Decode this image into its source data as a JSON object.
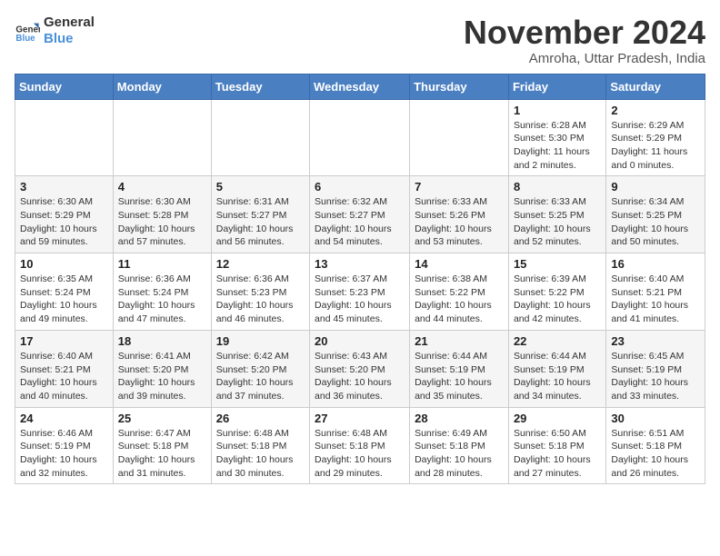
{
  "logo": {
    "line1": "General",
    "line2": "Blue"
  },
  "title": "November 2024",
  "location": "Amroha, Uttar Pradesh, India",
  "days_of_week": [
    "Sunday",
    "Monday",
    "Tuesday",
    "Wednesday",
    "Thursday",
    "Friday",
    "Saturday"
  ],
  "weeks": [
    [
      {
        "day": "",
        "info": ""
      },
      {
        "day": "",
        "info": ""
      },
      {
        "day": "",
        "info": ""
      },
      {
        "day": "",
        "info": ""
      },
      {
        "day": "",
        "info": ""
      },
      {
        "day": "1",
        "info": "Sunrise: 6:28 AM\nSunset: 5:30 PM\nDaylight: 11 hours and 2 minutes."
      },
      {
        "day": "2",
        "info": "Sunrise: 6:29 AM\nSunset: 5:29 PM\nDaylight: 11 hours and 0 minutes."
      }
    ],
    [
      {
        "day": "3",
        "info": "Sunrise: 6:30 AM\nSunset: 5:29 PM\nDaylight: 10 hours and 59 minutes."
      },
      {
        "day": "4",
        "info": "Sunrise: 6:30 AM\nSunset: 5:28 PM\nDaylight: 10 hours and 57 minutes."
      },
      {
        "day": "5",
        "info": "Sunrise: 6:31 AM\nSunset: 5:27 PM\nDaylight: 10 hours and 56 minutes."
      },
      {
        "day": "6",
        "info": "Sunrise: 6:32 AM\nSunset: 5:27 PM\nDaylight: 10 hours and 54 minutes."
      },
      {
        "day": "7",
        "info": "Sunrise: 6:33 AM\nSunset: 5:26 PM\nDaylight: 10 hours and 53 minutes."
      },
      {
        "day": "8",
        "info": "Sunrise: 6:33 AM\nSunset: 5:25 PM\nDaylight: 10 hours and 52 minutes."
      },
      {
        "day": "9",
        "info": "Sunrise: 6:34 AM\nSunset: 5:25 PM\nDaylight: 10 hours and 50 minutes."
      }
    ],
    [
      {
        "day": "10",
        "info": "Sunrise: 6:35 AM\nSunset: 5:24 PM\nDaylight: 10 hours and 49 minutes."
      },
      {
        "day": "11",
        "info": "Sunrise: 6:36 AM\nSunset: 5:24 PM\nDaylight: 10 hours and 47 minutes."
      },
      {
        "day": "12",
        "info": "Sunrise: 6:36 AM\nSunset: 5:23 PM\nDaylight: 10 hours and 46 minutes."
      },
      {
        "day": "13",
        "info": "Sunrise: 6:37 AM\nSunset: 5:23 PM\nDaylight: 10 hours and 45 minutes."
      },
      {
        "day": "14",
        "info": "Sunrise: 6:38 AM\nSunset: 5:22 PM\nDaylight: 10 hours and 44 minutes."
      },
      {
        "day": "15",
        "info": "Sunrise: 6:39 AM\nSunset: 5:22 PM\nDaylight: 10 hours and 42 minutes."
      },
      {
        "day": "16",
        "info": "Sunrise: 6:40 AM\nSunset: 5:21 PM\nDaylight: 10 hours and 41 minutes."
      }
    ],
    [
      {
        "day": "17",
        "info": "Sunrise: 6:40 AM\nSunset: 5:21 PM\nDaylight: 10 hours and 40 minutes."
      },
      {
        "day": "18",
        "info": "Sunrise: 6:41 AM\nSunset: 5:20 PM\nDaylight: 10 hours and 39 minutes."
      },
      {
        "day": "19",
        "info": "Sunrise: 6:42 AM\nSunset: 5:20 PM\nDaylight: 10 hours and 37 minutes."
      },
      {
        "day": "20",
        "info": "Sunrise: 6:43 AM\nSunset: 5:20 PM\nDaylight: 10 hours and 36 minutes."
      },
      {
        "day": "21",
        "info": "Sunrise: 6:44 AM\nSunset: 5:19 PM\nDaylight: 10 hours and 35 minutes."
      },
      {
        "day": "22",
        "info": "Sunrise: 6:44 AM\nSunset: 5:19 PM\nDaylight: 10 hours and 34 minutes."
      },
      {
        "day": "23",
        "info": "Sunrise: 6:45 AM\nSunset: 5:19 PM\nDaylight: 10 hours and 33 minutes."
      }
    ],
    [
      {
        "day": "24",
        "info": "Sunrise: 6:46 AM\nSunset: 5:19 PM\nDaylight: 10 hours and 32 minutes."
      },
      {
        "day": "25",
        "info": "Sunrise: 6:47 AM\nSunset: 5:18 PM\nDaylight: 10 hours and 31 minutes."
      },
      {
        "day": "26",
        "info": "Sunrise: 6:48 AM\nSunset: 5:18 PM\nDaylight: 10 hours and 30 minutes."
      },
      {
        "day": "27",
        "info": "Sunrise: 6:48 AM\nSunset: 5:18 PM\nDaylight: 10 hours and 29 minutes."
      },
      {
        "day": "28",
        "info": "Sunrise: 6:49 AM\nSunset: 5:18 PM\nDaylight: 10 hours and 28 minutes."
      },
      {
        "day": "29",
        "info": "Sunrise: 6:50 AM\nSunset: 5:18 PM\nDaylight: 10 hours and 27 minutes."
      },
      {
        "day": "30",
        "info": "Sunrise: 6:51 AM\nSunset: 5:18 PM\nDaylight: 10 hours and 26 minutes."
      }
    ]
  ]
}
